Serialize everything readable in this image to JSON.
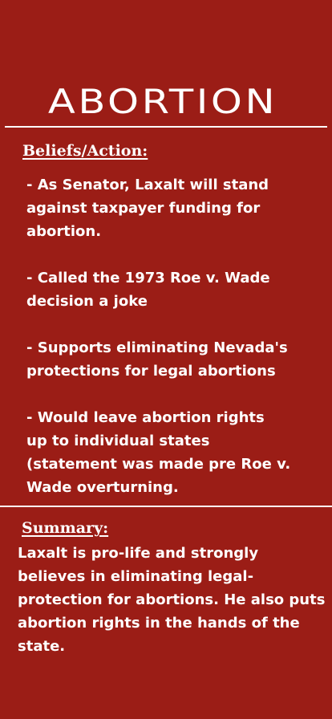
{
  "title": "ABORTION",
  "beliefs": {
    "heading": "Beliefs/Action:",
    "items": [
      "- As Senator, Laxalt will stand\nagainst taxpayer funding for\nabortion.",
      "- Called the 1973 Roe v. Wade\ndecision a joke",
      "- Supports eliminating Nevada's\nprotections for legal abortions",
      "- Would leave abortion rights\nup to individual states\n(statement was made pre Roe v.\nWade overturning."
    ]
  },
  "summary": {
    "heading": "Summary:",
    "text": "Laxalt is pro-life and strongly believes in eliminating legal-protection for abortions. He also puts abortion rights in the hands of the state."
  },
  "colors": {
    "background": "#9b1d16",
    "text": "#ffffff"
  }
}
